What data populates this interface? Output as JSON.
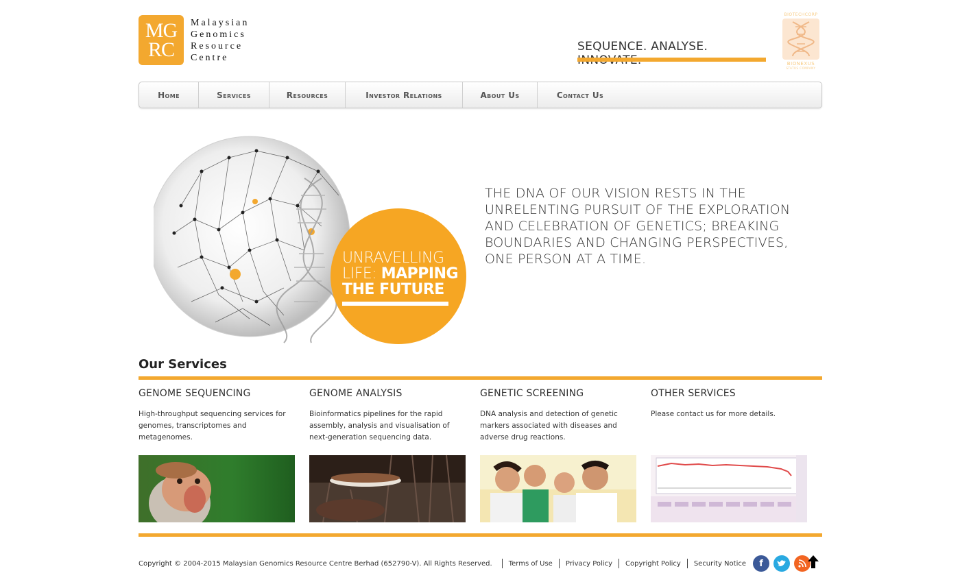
{
  "header": {
    "logo_mark_line1": "MG",
    "logo_mark_line2": "RC",
    "logo_text_lines": [
      "Malaysian",
      "Genomics",
      "Resource",
      "Centre"
    ],
    "tagline": "SEQUENCE. ANALYSE. INNOVATE.",
    "partner_top": "BIOTECHCORP",
    "partner_bottom": "BIONEXUS",
    "partner_sub": "STATUS COMPANY"
  },
  "nav": {
    "items": [
      {
        "label": "Home"
      },
      {
        "label": "Services"
      },
      {
        "label": "Resources"
      },
      {
        "label": "Investor Relations"
      },
      {
        "label": "About Us"
      },
      {
        "label": "Contact Us"
      }
    ]
  },
  "hero": {
    "circle_line1": "UNRAVELLING",
    "circle_line2a": "LIFE: ",
    "circle_line2b": "MAPPING",
    "circle_line3": "THE FUTURE",
    "vision_text": "THE DNA OF OUR VISION RESTS IN THE UNRELENTING PURSUIT OF THE EXPLORATION AND CELEBRATION OF GENETICS; BREAKING BOUNDARIES AND CHANGING PERSPECTIVES, ONE PERSON AT A TIME."
  },
  "services": {
    "heading": "Our Services",
    "items": [
      {
        "title": "GENOME SEQUENCING",
        "description": "High-throughput sequencing services for genomes, transcriptomes and metagenomes."
      },
      {
        "title": "GENOME ANALYSIS",
        "description": "Bioinformatics pipelines for the rapid assembly, analysis and visualisation of next-generation sequencing data."
      },
      {
        "title": "GENETIC SCREENING",
        "description": "DNA analysis and detection of genetic markers associated with diseases and adverse drug reactions."
      },
      {
        "title": "OTHER SERVICES",
        "description": "Please contact us for more details."
      }
    ]
  },
  "footer": {
    "copyright": "Copyright © 2004-2015 Malaysian Genomics Resource Centre Berhad (652790-V). All Rights Reserved.",
    "links": [
      "Terms of Use",
      "Privacy Policy",
      "Copyright Policy",
      "Security Notice"
    ]
  },
  "colors": {
    "accent": "#f3a82f",
    "facebook": "#3b5998",
    "twitter": "#29a9e1",
    "rss": "#f26522"
  },
  "icons": {
    "facebook": "facebook-icon",
    "twitter": "twitter-icon",
    "rss": "rss-icon",
    "back_to_top": "arrow-up-icon"
  }
}
